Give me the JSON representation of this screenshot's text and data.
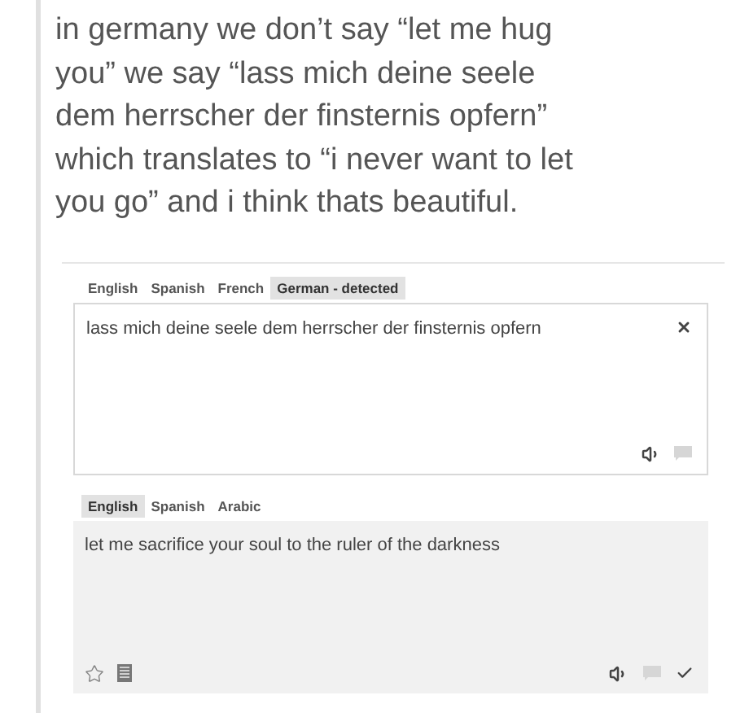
{
  "quote": {
    "lines": [
      "in germany we don’t say “let me hug",
      "you” we say “lass mich deine seele",
      "dem herrscher der finsternis opfern”",
      "which translates to “i never want to let",
      "you go” and i think thats beautiful."
    ]
  },
  "source": {
    "tabs": [
      {
        "label": "English",
        "selected": false
      },
      {
        "label": "Spanish",
        "selected": false
      },
      {
        "label": "French",
        "selected": false
      },
      {
        "label": "German - detected",
        "selected": true
      }
    ],
    "text": "lass mich deine seele dem herrscher der finsternis opfern"
  },
  "target": {
    "tabs": [
      {
        "label": "English",
        "selected": true
      },
      {
        "label": "Spanish",
        "selected": false
      },
      {
        "label": "Arabic",
        "selected": false
      }
    ],
    "text": "let me sacrifice your soul to the ruler of the darkness"
  }
}
